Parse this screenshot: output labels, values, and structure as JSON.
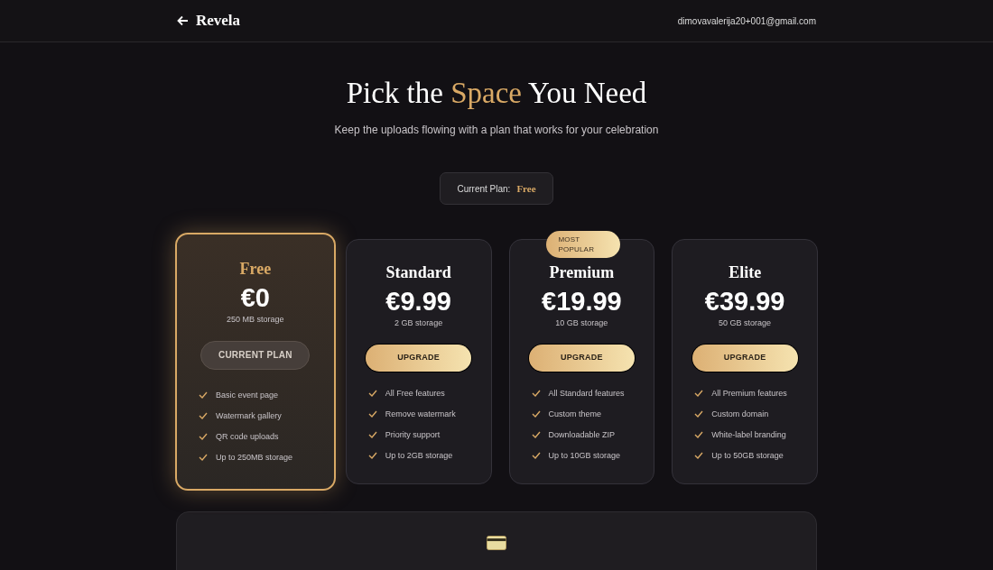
{
  "header": {
    "brand": "Revela",
    "email": "dimovavalerija20+001@gmail.com"
  },
  "hero": {
    "title": "Pick the **Space** You Need",
    "subtitle": "Keep the uploads flowing with a plan that works for your celebration"
  },
  "current_plan": {
    "label": "Current Plan:",
    "value": "Free"
  },
  "plans": [
    {
      "name": "Free",
      "price": "€0",
      "storage": "250 MB storage",
      "selected": true,
      "button": {
        "kind": "current",
        "label": "CURRENT PLAN"
      },
      "features": [
        "Basic event page",
        "Watermark gallery",
        "QR code uploads",
        "Up to 250MB storage"
      ]
    },
    {
      "name": "Standard",
      "price": "€9.99",
      "storage": "2 GB storage",
      "selected": false,
      "button": {
        "kind": "upgrade",
        "label": "UPGRADE"
      },
      "features": [
        "All Free features",
        "Remove watermark",
        "Priority support",
        "Up to 2GB storage"
      ]
    },
    {
      "name": "Premium",
      "price": "€19.99",
      "storage": "10 GB storage",
      "selected": false,
      "badge": "MOST POPULAR",
      "button": {
        "kind": "upgrade",
        "label": "UPGRADE"
      },
      "features": [
        "All Standard features",
        "Custom theme",
        "Downloadable ZIP",
        "Up to 10GB storage"
      ]
    },
    {
      "name": "Elite",
      "price": "€39.99",
      "storage": "50 GB storage",
      "selected": false,
      "button": {
        "kind": "upgrade",
        "label": "UPGRADE"
      },
      "features": [
        "All Premium features",
        "Custom domain",
        "White-label branding",
        "Up to 50GB storage"
      ]
    }
  ]
}
